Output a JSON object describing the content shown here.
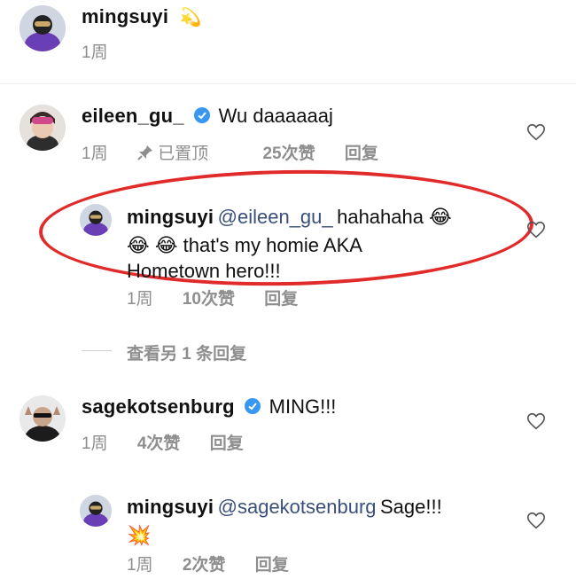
{
  "post": {
    "username": "mingsuyi",
    "caption_emoji": "💫",
    "time": "1周"
  },
  "comments": [
    {
      "username": "eileen_gu_",
      "verified": true,
      "text": "Wu daaaaaaj",
      "time": "1周",
      "pinned_label": "已置顶",
      "likes": "25次赞",
      "reply_label": "回复"
    },
    {
      "username": "mingsuyi",
      "mention": "@eileen_gu_",
      "text_line1": "hahahaha 😂",
      "text_line2": "😂 😂 that's my homie AKA",
      "text_line3": "Hometown hero!!!",
      "time": "1周",
      "likes": "10次赞",
      "reply_label": "回复"
    },
    {
      "view_replies": "查看另 1 条回复"
    },
    {
      "username": "sagekotsenburg",
      "verified": true,
      "text": "MING!!!",
      "time": "1周",
      "likes": "4次赞",
      "reply_label": "回复"
    },
    {
      "username": "mingsuyi",
      "mention": "@sagekotsenburg",
      "text": "Sage!!!",
      "text_line2": "💥",
      "time": "1周",
      "likes": "2次赞",
      "reply_label": "回复"
    }
  ]
}
